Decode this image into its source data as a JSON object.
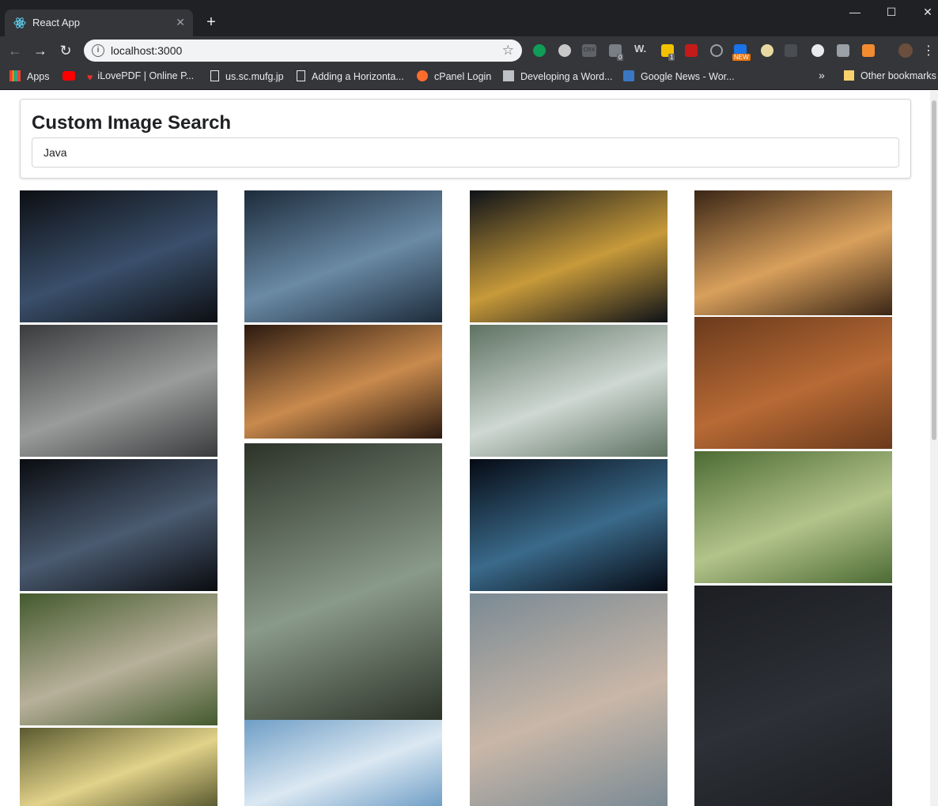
{
  "browser": {
    "tab_title": "React App",
    "url": "localhost:3000",
    "bookmarks": [
      {
        "label": "Apps",
        "icon": "apps-grid-icon"
      },
      {
        "label": "",
        "icon": "youtube-icon"
      },
      {
        "label": "iLovePDF | Online P...",
        "icon": "ilovepdf-heart-icon"
      },
      {
        "label": "us.sc.mufg.jp",
        "icon": "page-icon"
      },
      {
        "label": "Adding a Horizonta...",
        "icon": "page-icon"
      },
      {
        "label": "cPanel Login",
        "icon": "cpanel-icon"
      },
      {
        "label": "Developing a Word...",
        "icon": "printer-icon"
      },
      {
        "label": "Google News - Wor...",
        "icon": "rss-icon"
      }
    ],
    "other_bookmarks": "Other bookmarks",
    "extension_badges": [
      "0",
      "1"
    ],
    "extension_new_badge": "NEW",
    "crx_label": "CRX"
  },
  "page": {
    "title": "Custom Image Search",
    "search_value": "Java"
  },
  "images": [
    {
      "subject": "laptop code editor",
      "colors": [
        "#0d0f13",
        "#3a4f6b"
      ]
    },
    {
      "subject": "colorful code monitor",
      "colors": [
        "#1d2c3c",
        "#6a8aa5"
      ]
    },
    {
      "subject": "javascript source code",
      "colors": [
        "#0e1218",
        "#c79a3a"
      ]
    },
    {
      "subject": "latte art coffee cup",
      "colors": [
        "#3a2616",
        "#d9a05c"
      ]
    },
    {
      "subject": "volcanic rocky landscape",
      "colors": [
        "#3a3b3c",
        "#9a9b9b"
      ]
    },
    {
      "subject": "latte on wooden table",
      "colors": [
        "#2b1a10",
        "#c98a4d"
      ]
    },
    {
      "subject": "volcano with hiker",
      "colors": [
        "#5e7262",
        "#cfd8d3"
      ]
    },
    {
      "subject": "coffee with brass bell",
      "colors": [
        "#6a3a1c",
        "#b86a35"
      ]
    },
    {
      "subject": "person silhouette at code screens",
      "colors": [
        "#0a0c10",
        "#4a5a70"
      ]
    },
    {
      "subject": "jungle waterfall",
      "colors": [
        "#2c3328",
        "#8a9a8a"
      ]
    },
    {
      "subject": "matrix colored code",
      "colors": [
        "#060a14",
        "#3a6a8a"
      ]
    },
    {
      "subject": "rice field path",
      "colors": [
        "#4d6b35",
        "#b3c48a"
      ]
    },
    {
      "subject": "buddha statue temple",
      "colors": [
        "#435a2e",
        "#b8b09a"
      ]
    },
    {
      "subject": "hiker on misty ridge",
      "colors": [
        "#7a8a94",
        "#c9b7a8"
      ]
    },
    {
      "subject": "dark code editor",
      "colors": [
        "#1c1e22",
        "#2d3036"
      ]
    },
    {
      "subject": "palm trees sunset",
      "colors": [
        "#5a5a30",
        "#e2d28a"
      ]
    },
    {
      "subject": "mountains above clouds",
      "colors": [
        "#6f9ec6",
        "#dbe8f2"
      ]
    }
  ]
}
